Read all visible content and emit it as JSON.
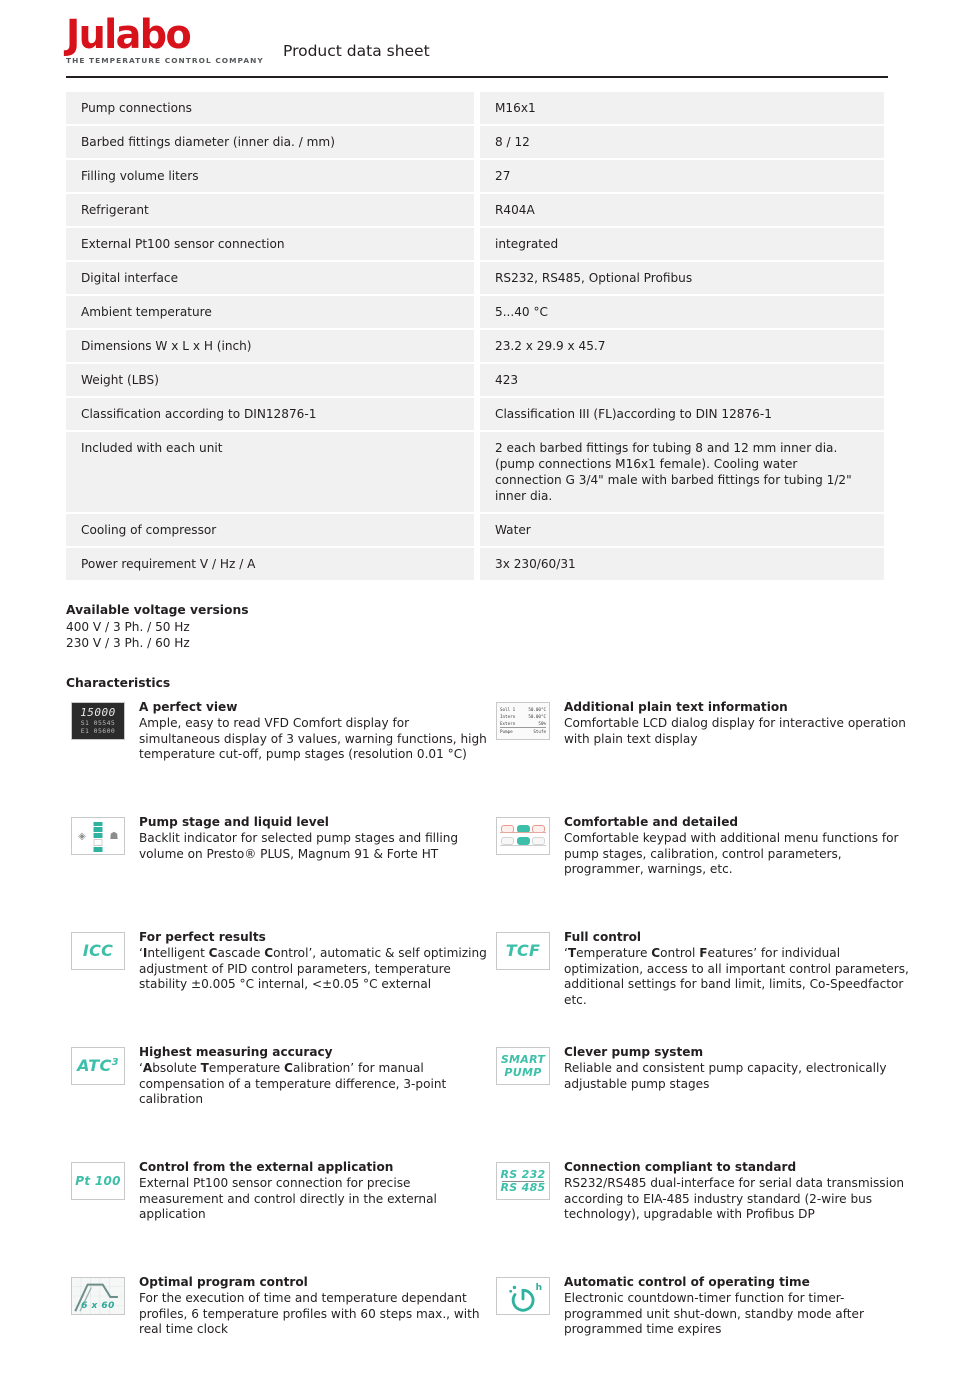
{
  "header": {
    "logo_word": "Julabo",
    "logo_tagline": "THE TEMPERATURE CONTROL COMPANY",
    "title": "Product data sheet"
  },
  "spec_table": {
    "rows": [
      {
        "label": "Pump connections",
        "value": "M16x1"
      },
      {
        "label": "Barbed fittings diameter (inner dia. / mm)",
        "value": "8 / 12"
      },
      {
        "label": "Filling volume liters",
        "value": "27"
      },
      {
        "label": "Refrigerant",
        "value": "R404A"
      },
      {
        "label": "External Pt100 sensor connection",
        "value": "integrated"
      },
      {
        "label": "Digital interface",
        "value": "RS232, RS485, Optional Profibus"
      },
      {
        "label": "Ambient temperature",
        "value": "5...40 °C"
      },
      {
        "label": "Dimensions W x L x H (inch)",
        "value": "23.2 x 29.9 x 45.7"
      },
      {
        "label": "Weight (LBS)",
        "value": "423"
      },
      {
        "label": "Classification according to DIN12876-1",
        "value": "Classification III (FL)according to DIN 12876-1"
      },
      {
        "label": "Included with each unit",
        "value": "2 each barbed fittings for tubing 8 and 12 mm inner dia.\n(pump connections M16x1 female). Cooling water\nconnection G 3/4\" male with barbed fittings for tubing 1/2\"\ninner dia."
      },
      {
        "label": "Cooling of compressor",
        "value": "Water"
      },
      {
        "label": "Power requirement V / Hz / A",
        "value": "3x 230/60/31"
      }
    ]
  },
  "voltage": {
    "heading": "Available voltage versions",
    "line1": "400 V / 3 Ph. / 50 Hz",
    "line2": "230 V / 3 Ph. / 60 Hz"
  },
  "characteristics": {
    "heading": "Characteristics",
    "items": [
      {
        "icon": "vfd-display-icon",
        "icon_text": {
          "line1": "15000",
          "line2": "S1 05545",
          "line3": "E1 05600"
        },
        "title": "A perfect view",
        "desc": "Ample, easy to read VFD Comfort display for simultaneous display of 3 values, warning functions, high temperature cut-off, pump stages (resolution 0.01 °C)"
      },
      {
        "icon": "lcd-plain-text-icon",
        "icon_text": {
          "l1a": "Soll 1",
          "l1b": "50.00°C",
          "l2a": "Intern",
          "l2b": "50.00°C",
          "l3a": "Extern",
          "l3b": "50%",
          "l4a": "Pumpe",
          "l4b": "Stufe"
        },
        "title": "Additional plain text information",
        "desc": "Comfortable LCD dialog display for interactive operation with plain text display"
      },
      {
        "icon": "pump-stage-level-icon",
        "icon_text": {
          "left": "◈",
          "right": "☗"
        },
        "title": "Pump stage and liquid level",
        "desc": "Backlit indicator for selected pump stages and filling volume on Presto® PLUS, Magnum 91 & Forte HT"
      },
      {
        "icon": "keypad-icon",
        "icon_text": {},
        "title": "Comfortable and detailed",
        "desc": "Comfortable keypad with additional menu functions for pump stages, calibration, control parameters, programmer, warnings, etc."
      },
      {
        "icon": "icc-logo-icon",
        "icon_text": {
          "line1": "ICC"
        },
        "title": "For perfect results",
        "desc_html": "‘<b>I</b>ntelligent <b>C</b>ascade <b>C</b>ontrol’, automatic &amp; self optimizing adjustment of PID control parameters, temperature stability ±0.005 °C internal, &lt;±0.05 °C external",
        "desc": "‘Intelligent Cascade Control’, automatic & self optimizing adjustment of PID control parameters, temperature stability ±0.005 °C internal, <±0.05 °C external"
      },
      {
        "icon": "tcf-logo-icon",
        "icon_text": {
          "line1": "TCF"
        },
        "title": "Full control",
        "desc_html": "‘<b>T</b>emperature <b>C</b>ontrol <b>F</b>eatures’ for individual optimization, access to all important control parameters, additional settings for band limit, limits, Co-Speedfactor etc.",
        "desc": "‘Temperature Control Features’ for individual optimization, access to all important control parameters, additional settings for band limit, limits, Co-Speedfactor etc."
      },
      {
        "icon": "atc3-logo-icon",
        "icon_text": {
          "line1": "ATC",
          "sup": "3"
        },
        "title": "Highest measuring accuracy",
        "desc_html": "‘<b>A</b>bsolute <b>T</b>emperature <b>C</b>alibration’ for manual compensation of a temperature difference, 3-point calibration",
        "desc": "‘Absolute Temperature Calibration’ for manual compensation of a temperature difference, 3-point calibration"
      },
      {
        "icon": "smart-pump-logo-icon",
        "icon_text": {
          "line1": "SMART",
          "line2": "PUMP"
        },
        "title": "Clever pump system",
        "desc": "Reliable and consistent pump capacity, electronically adjustable pump stages"
      },
      {
        "icon": "pt100-logo-icon",
        "icon_text": {
          "line1": "Pt 100"
        },
        "title": "Control from the external application",
        "desc": "External Pt100 sensor connection for precise measurement and control directly in the external application"
      },
      {
        "icon": "rs232-rs485-logo-icon",
        "icon_text": {
          "line1": "RS 232",
          "line2": "RS 485"
        },
        "title": "Connection compliant to standard",
        "desc": "RS232/RS485 dual-interface for serial data transmission according to EIA-485 industry standard (2-wire bus technology), upgradable with Profibus DP"
      },
      {
        "icon": "program-profile-icon",
        "icon_text": {
          "label": "6 x 60"
        },
        "title": "Optimal program control",
        "desc": "For the execution of time and temperature dependant profiles, 6 temperature profiles with 60 steps max., with real time clock"
      },
      {
        "icon": "countdown-timer-icon",
        "icon_text": {
          "sup": "h"
        },
        "title": "Automatic control of operating time",
        "desc": "Electronic countdown-timer function for timer-programmed unit shut-down, standby mode after programmed time expires"
      }
    ]
  },
  "colors": {
    "brand_red": "#d8121b",
    "accent_teal": "#3dbfa9",
    "table_row_bg": "#f1f1f1",
    "text": "#231f20"
  }
}
